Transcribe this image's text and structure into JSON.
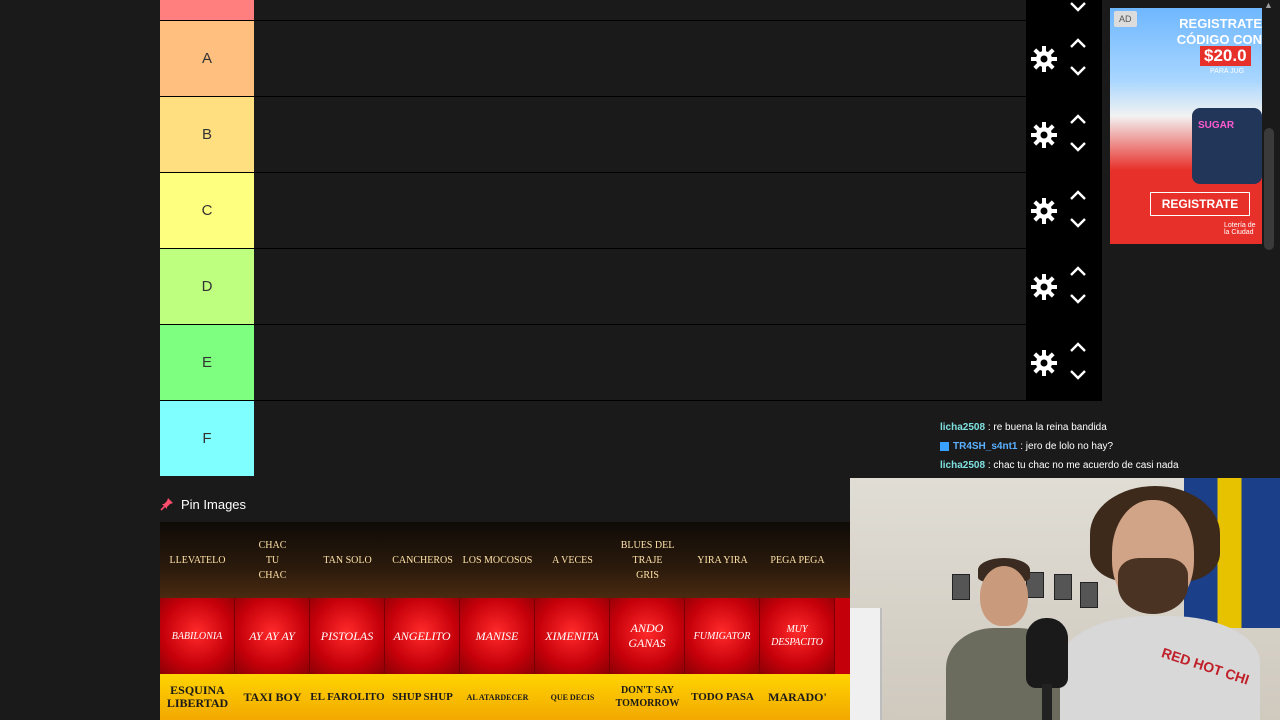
{
  "tiers": [
    {
      "label": "",
      "color": "#ff7f7f"
    },
    {
      "label": "A",
      "color": "#ffbf7f"
    },
    {
      "label": "B",
      "color": "#ffdf80"
    },
    {
      "label": "C",
      "color": "#ffff7f"
    },
    {
      "label": "D",
      "color": "#bfff7f"
    },
    {
      "label": "E",
      "color": "#7fff7f"
    },
    {
      "label": "F",
      "color": "#7fffff"
    }
  ],
  "ad": {
    "badge": "AD",
    "title": "REGISTRATE CÓDIGO CON",
    "amount": "$20.0",
    "sub": "PARA JUG",
    "game": "SUGAR",
    "cta": "REGISTRATE",
    "logo": "Lotería de la Ciudad"
  },
  "chat": [
    {
      "user": "licha2508",
      "user_color": "#7fe0e0",
      "message": " : re buena la reina bandida",
      "badge": false
    },
    {
      "user": "TR4SH_s4nt1",
      "user_color": "#5bb0ff",
      "message": " : jero de lolo no hay?",
      "badge": true
    },
    {
      "user": "licha2508",
      "user_color": "#7fe0e0",
      "message": " : chac tu chac no me acuerdo de casi nada",
      "badge": false
    }
  ],
  "pin": {
    "label": "Pin Images",
    "icon": "pin-icon"
  },
  "bank": {
    "row1": [
      "LLEVATELO",
      "CHAC TU CHAC",
      "TAN SOLO",
      "CANCHEROS",
      "LOS MOCOSOS",
      "A VECES",
      "BLUES DEL TRAJE GRIS",
      "YIRA YIRA",
      "PEGA PEGA"
    ],
    "row2": [
      "BABILONIA",
      "AY AY AY",
      "PISTOLAS",
      "ANGELITO",
      "MANISE",
      "XIMENITA",
      "ANDO GANAS",
      "FUMIGATOR",
      "MUY DESPACITO"
    ],
    "row3": [
      "ESQUINA LIBERTAD",
      "TAXI BOY",
      "EL FAROLITO",
      "SHUP SHUP",
      "AL ATARDECER",
      "QUE DECIS",
      "DON'T SAY TOMORROW",
      "TODO PASA",
      "MARADO'"
    ]
  },
  "webcam": {
    "shirt_text": "RED HOT CHI"
  },
  "colors": {
    "background": "#1a1a1a",
    "controls": "#000000",
    "ad_red": "#e8302a"
  }
}
